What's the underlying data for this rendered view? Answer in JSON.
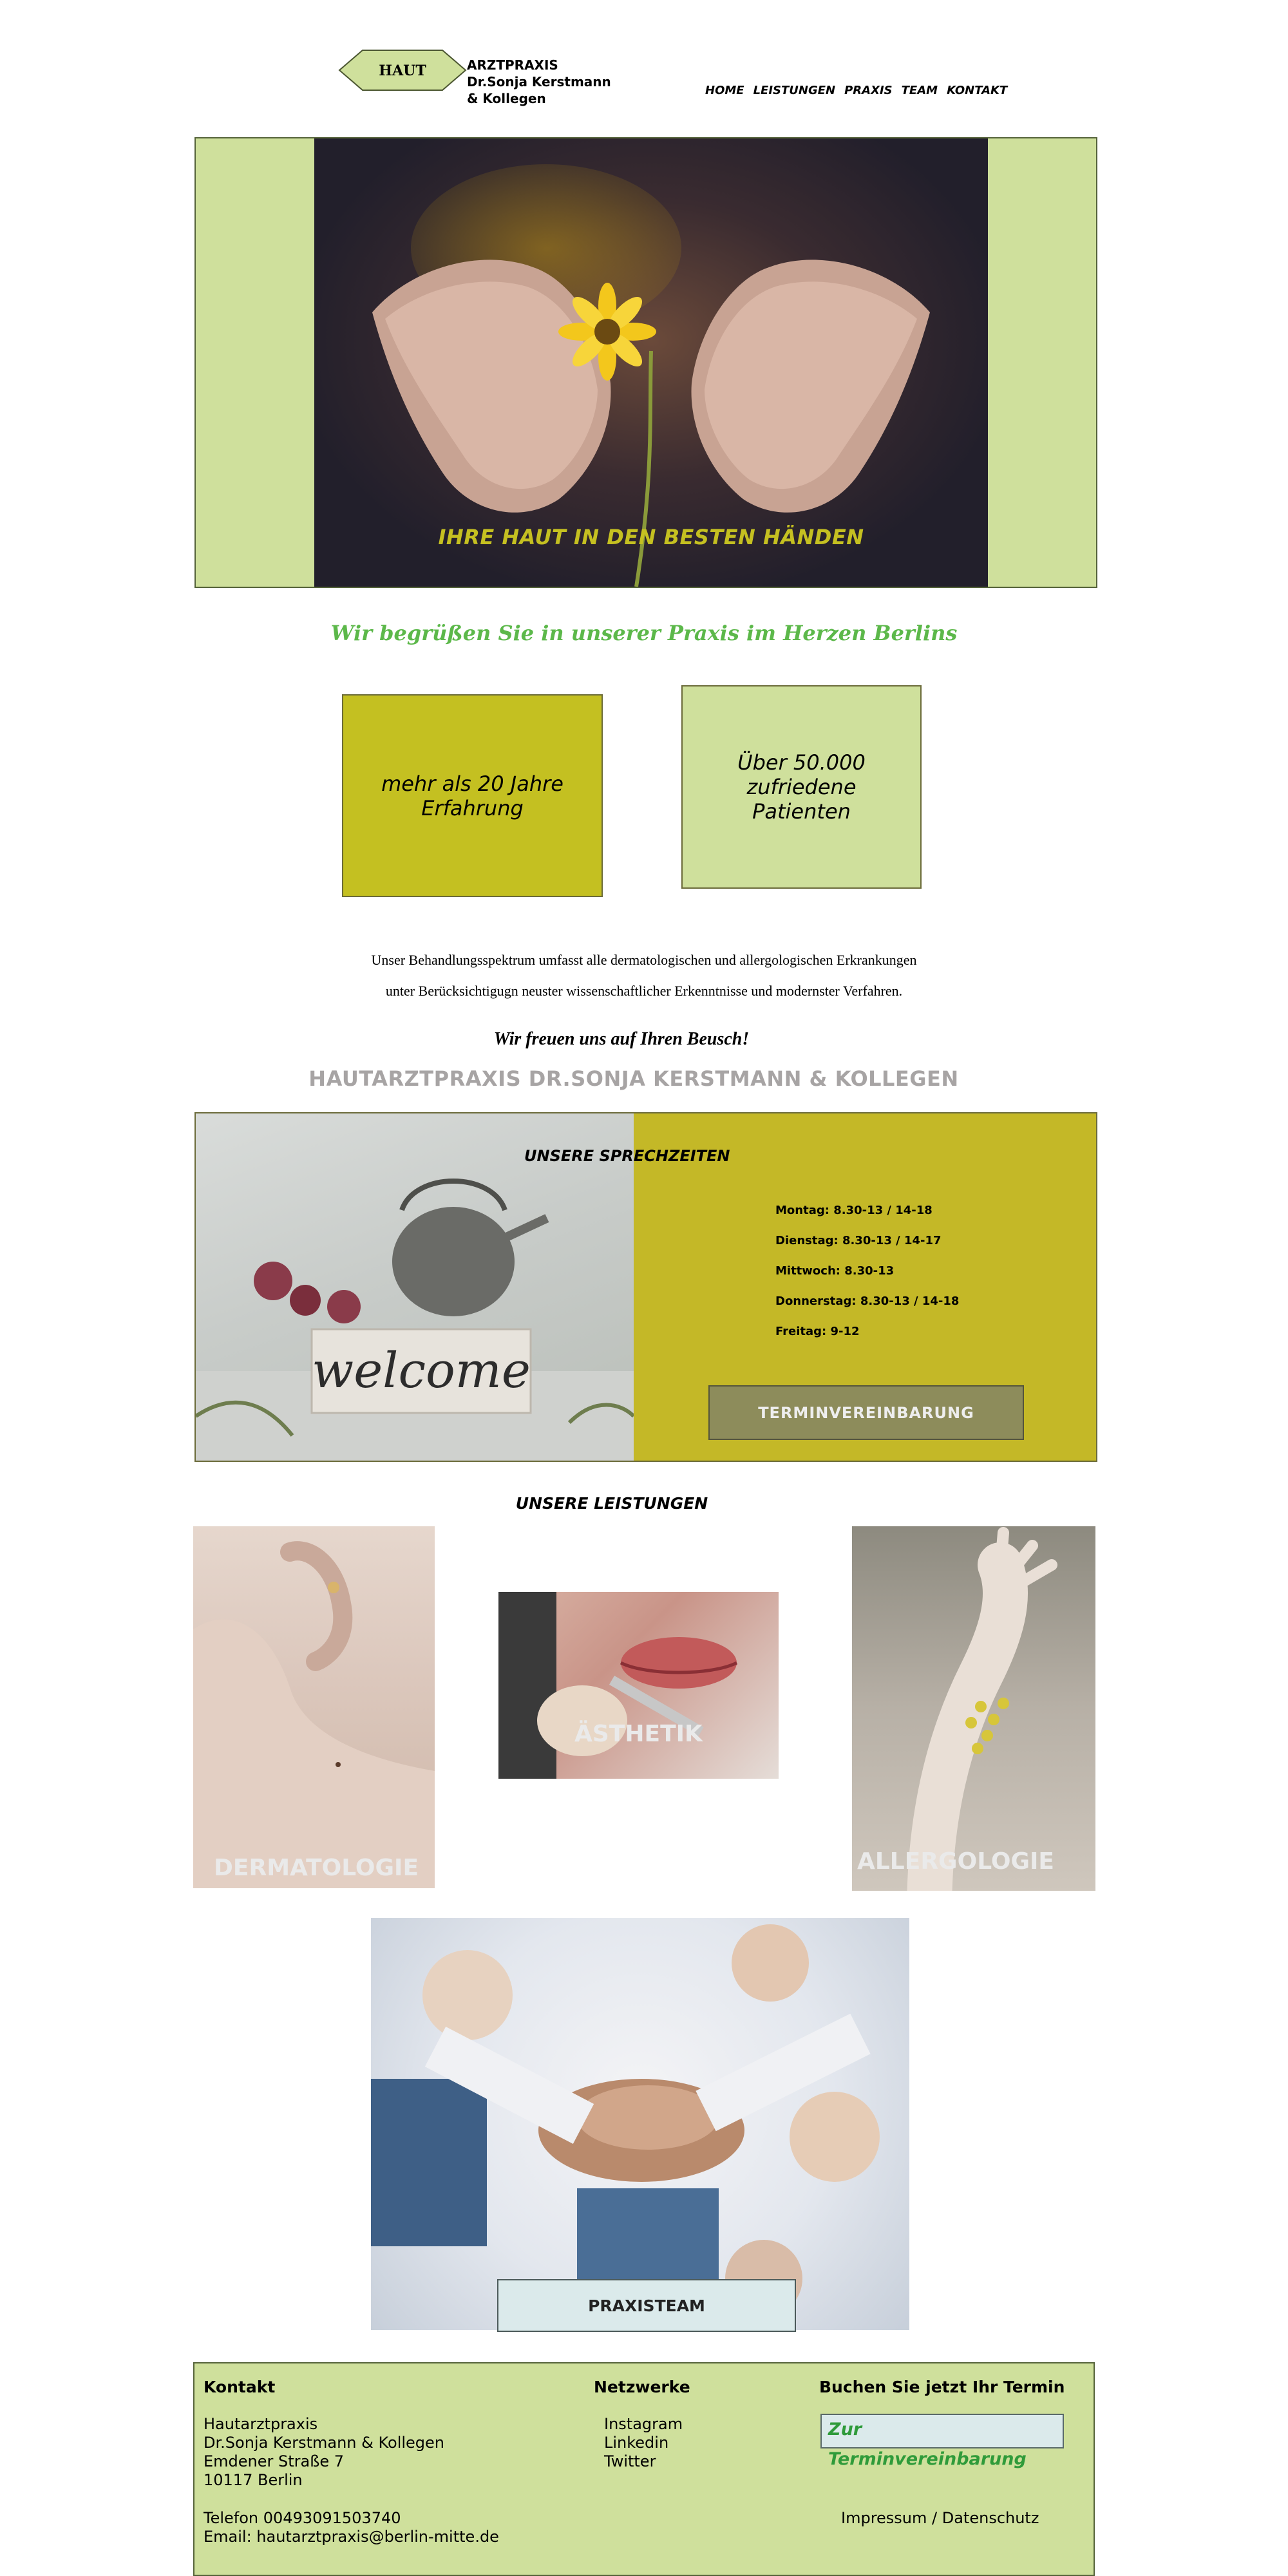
{
  "header": {
    "logo_badge": "HAUT",
    "logo_line1": "ARZTPRAXIS",
    "logo_line2": "Dr.Sonja Kerstmann",
    "logo_line3": "& Kollegen",
    "nav": [
      "HOME",
      "LEISTUNGEN",
      "PRAXIS",
      "TEAM",
      "KONTAKT"
    ]
  },
  "hero": {
    "caption": "IHRE HAUT IN DEN BESTEN HÄNDEN"
  },
  "welcome": "Wir begrüßen Sie in unserer Praxis im Herzen Berlins",
  "stats": [
    {
      "line1": "mehr als 20 Jahre",
      "line2": "Erfahrung"
    },
    {
      "line1": "Über 50.000 zufriedene",
      "line2": "Patienten"
    }
  ],
  "intro": {
    "line1": "Unser Behandlungsspektrum umfasst alle dermatologischen und allergologischen Erkrankungen",
    "line2": "unter Berücksichtigugn neuster wissenschaftlicher Erkenntnisse und modernster Verfahren.",
    "freuen": "Wir freuen uns auf Ihren Beusch!",
    "praxis_name": "HAUTARZTPRAXIS DR.SONJA KERSTMANN & KOLLEGEN"
  },
  "hours": {
    "title": "UNSERE SPRECHZEITEN",
    "photo_word": "welcome",
    "days": [
      "Montag: 8.30-13 / 14-18",
      "Dienstag: 8.30-13 / 14-17",
      "Mittwoch: 8.30-13",
      "Donnerstag: 8.30-13 / 14-18",
      "Freitag: 9-12"
    ],
    "button": "TERMINVEREINBARUNG"
  },
  "services": {
    "title": "UNSERE LEISTUNGEN",
    "derma": "DERMATOLOGIE",
    "aesthetik": "ÄSTHETIK",
    "allergo": "ALLERGOLOGIE"
  },
  "team": {
    "label": "PRAXISTEAM"
  },
  "footer": {
    "kontakt_title": "Kontakt",
    "address": [
      "Hautarztpraxis",
      "Dr.Sonja Kerstmann & Kollegen",
      "Emdener Straße 7",
      "10117 Berlin"
    ],
    "phone": "Telefon 00493091503740",
    "email": "Email: hautarztpraxis@berlin-mitte.de",
    "netzwerke_title": "Netzwerke",
    "networks": [
      "Instagram",
      "Linkedin",
      "Twitter"
    ],
    "buchen_title": "Buchen Sie jetzt Ihr Termin",
    "termin_link": "Zur Terminvereinbarung",
    "legal": "Impressum / Datenschutz"
  },
  "colors": {
    "lime_light": "#cfe09c",
    "olive_yellow": "#c4c021",
    "mustard": "#c4b827",
    "welcome_green": "#5cb84a",
    "grey_title": "#a7a4a4"
  }
}
